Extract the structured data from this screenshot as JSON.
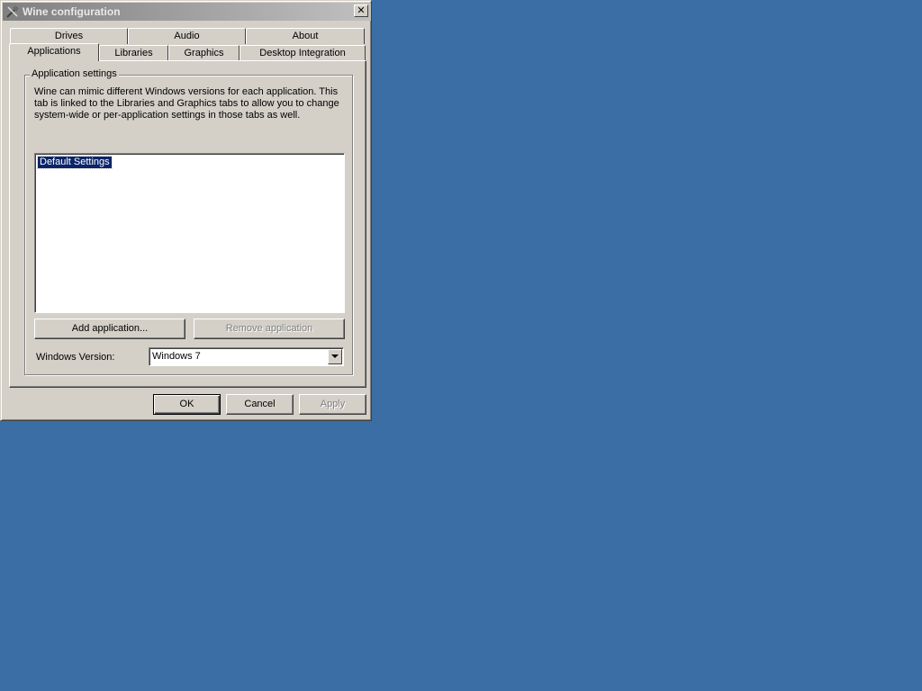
{
  "window": {
    "title": "Wine configuration",
    "close_symbol": "✕"
  },
  "tabs": {
    "row_top": [
      {
        "label": "Drives"
      },
      {
        "label": "Audio"
      },
      {
        "label": "About"
      }
    ],
    "row_bottom": [
      {
        "label": "Applications",
        "active": true
      },
      {
        "label": "Libraries"
      },
      {
        "label": "Graphics"
      },
      {
        "label": "Desktop Integration"
      }
    ]
  },
  "app_settings": {
    "group_title": "Application settings",
    "description": "Wine can mimic different Windows versions for each application. This tab is linked to the Libraries and Graphics tabs to allow you to change system-wide or per-application settings in those tabs as well.",
    "list_items": [
      "Default Settings"
    ],
    "add_button": "Add application...",
    "remove_button": "Remove application",
    "version_label": "Windows Version:",
    "version_value": "Windows 7"
  },
  "footer": {
    "ok": "OK",
    "cancel": "Cancel",
    "apply": "Apply"
  },
  "colors": {
    "desktop": "#3a6ea5",
    "window_face": "#d4d0c8",
    "selection": "#0a246a"
  },
  "icons": {
    "title": "tools-icon",
    "combo": "chevron-down-icon"
  }
}
